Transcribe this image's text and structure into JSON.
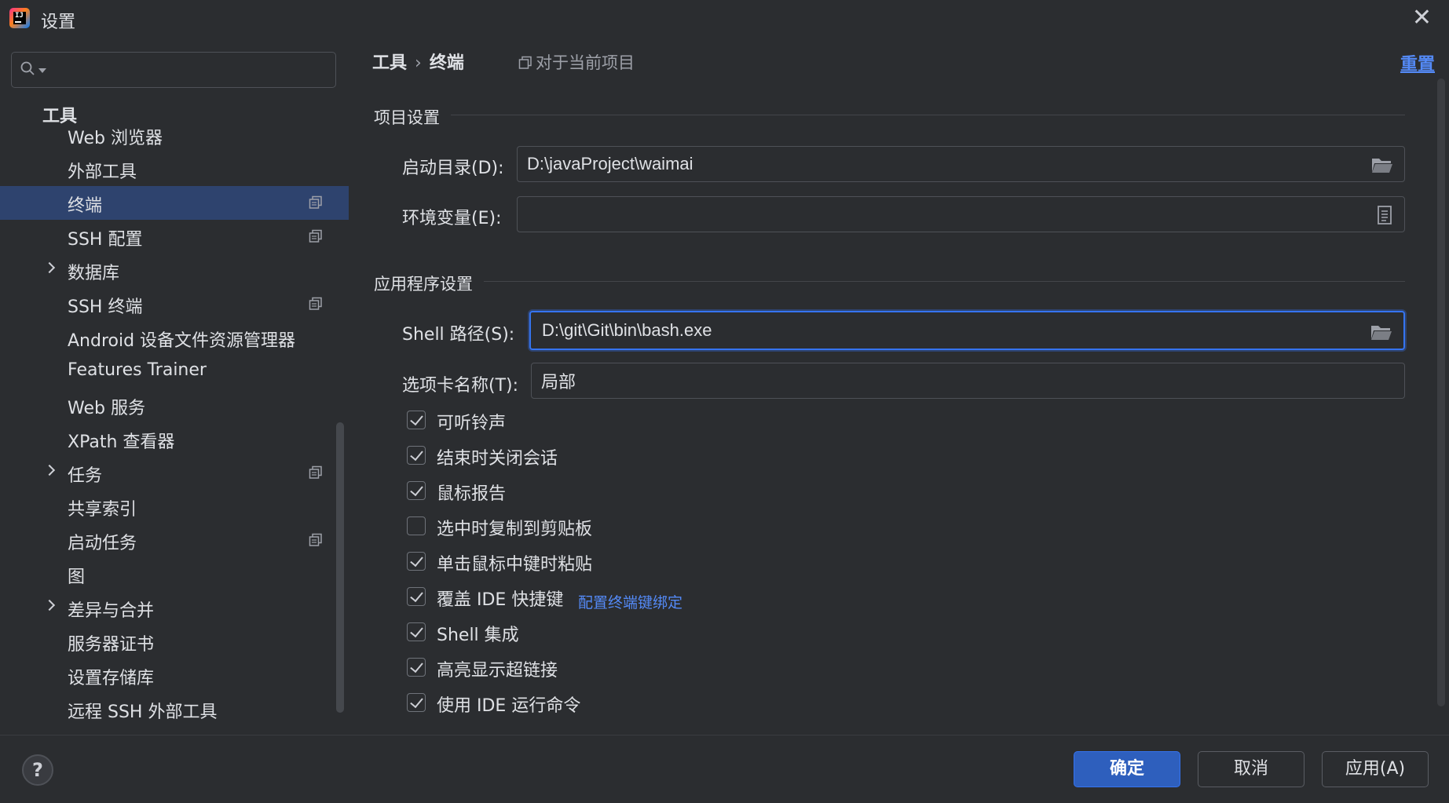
{
  "window": {
    "title": "设置",
    "close_glyph": "✕"
  },
  "search": {
    "placeholder": "",
    "value": ""
  },
  "sidebar": {
    "root_label": "工具",
    "items": [
      {
        "label": "Web 浏览器"
      },
      {
        "label": "外部工具"
      },
      {
        "label": "终端"
      },
      {
        "label": "SSH 配置"
      },
      {
        "label": "数据库"
      },
      {
        "label": "SSH 终端"
      },
      {
        "label": "Android 设备文件资源管理器"
      },
      {
        "label": "Features Trainer"
      },
      {
        "label": "Web 服务"
      },
      {
        "label": "XPath 查看器"
      },
      {
        "label": "任务"
      },
      {
        "label": "共享索引"
      },
      {
        "label": "启动任务"
      },
      {
        "label": "图"
      },
      {
        "label": "差异与合并"
      },
      {
        "label": "服务器证书"
      },
      {
        "label": "设置存储库"
      },
      {
        "label": "远程 SSH 外部工具"
      }
    ]
  },
  "header": {
    "breadcrumb_parent": "工具",
    "breadcrumb_sep": "›",
    "breadcrumb_current": "终端",
    "scope_note": "对于当前项目",
    "reset_label": "重置"
  },
  "project_settings": {
    "section_title": "项目设置",
    "start_dir_label": "启动目录(D):",
    "start_dir_value": "D:\\javaProject\\waimai",
    "env_label": "环境变量(E):",
    "env_value": ""
  },
  "app_settings": {
    "section_title": "应用程序设置",
    "shell_label": "Shell 路径(S):",
    "shell_value": "D:\\git\\Git\\bin\\bash.exe",
    "tab_name_label": "选项卡名称(T):",
    "tab_name_value": "局部"
  },
  "checkboxes": [
    {
      "label": "可听铃声",
      "checked": true
    },
    {
      "label": "结束时关闭会话",
      "checked": true
    },
    {
      "label": "鼠标报告",
      "checked": true
    },
    {
      "label": "选中时复制到剪贴板",
      "checked": false
    },
    {
      "label": "单击鼠标中键时粘贴",
      "checked": true
    },
    {
      "label": "覆盖 IDE 快捷键",
      "checked": true
    },
    {
      "label": "Shell 集成",
      "checked": true
    },
    {
      "label": "高亮显示超链接",
      "checked": true
    },
    {
      "label": "使用 IDE 运行命令",
      "checked": true
    }
  ],
  "keybinding_link": "配置终端键绑定",
  "footer": {
    "help_label": "?",
    "ok_label": "确定",
    "cancel_label": "取消",
    "apply_label": "应用(A)"
  },
  "colors": {
    "background": "#2b2d30",
    "selection": "#2e436e",
    "accent": "#3574f0",
    "link": "#548af7"
  }
}
